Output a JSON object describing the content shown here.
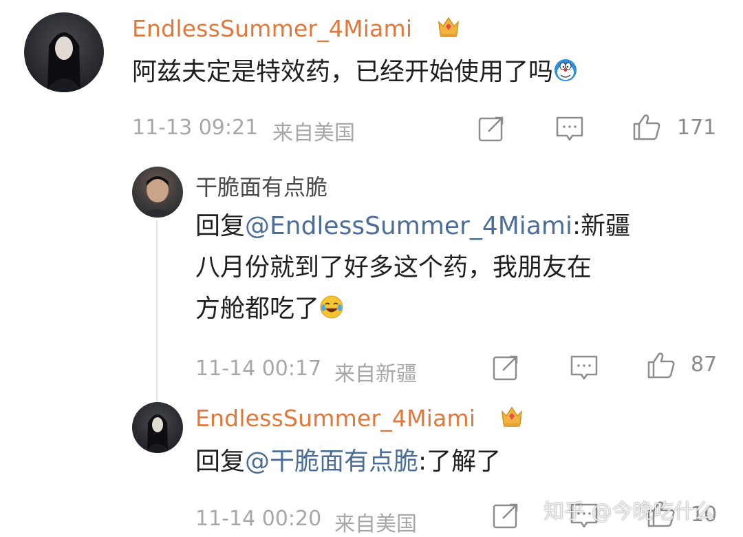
{
  "comments": [
    {
      "username": "EndlessSummer_4Miami",
      "text": "阿兹夫定是特效药，已经开始使用了吗",
      "time": "11-13 09:21",
      "location": "来自美国",
      "likes": "171"
    },
    {
      "username": "干脆面有点脆",
      "reply_prefix": "回复",
      "mention": "@EndlessSummer_4Miami",
      "text_line1": ":新疆",
      "text_line2": "八月份就到了好多这个药，我朋友在",
      "text_line3": "方舱都吃了",
      "time": "11-14 00:17",
      "location": "来自新疆",
      "likes": "87"
    },
    {
      "username": "EndlessSummer_4Miami",
      "reply_prefix": "回复",
      "mention": "@干脆面有点脆",
      "text": ":了解了",
      "time": "11-14 00:20",
      "location": "来自美国",
      "likes": "10"
    }
  ],
  "watermark": "知乎 @今晚吃什么",
  "icons": {
    "share": "share-icon",
    "comment": "comment-icon",
    "like": "like-icon",
    "vip": "crown-icon"
  },
  "colors": {
    "username": "#e2773a",
    "mention": "#4b6d98",
    "meta": "#a7a7a7"
  }
}
